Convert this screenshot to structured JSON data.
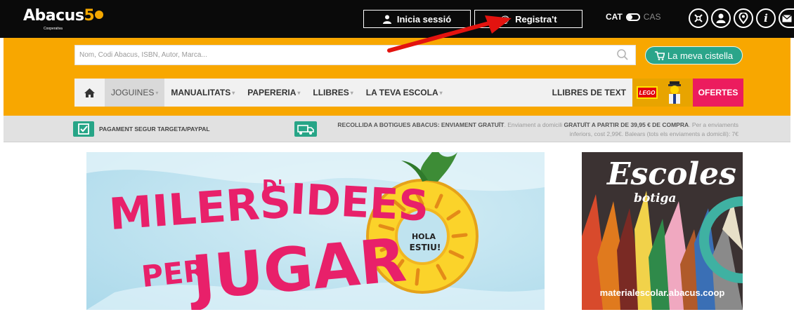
{
  "header": {
    "logo_text": "Abacus",
    "logo_number": "5",
    "logo_subtitle": "Cooperativa",
    "login_label": "Inicia sessió",
    "register_label": "Registra't",
    "lang_active": "CAT",
    "lang_inactive": "CAS",
    "icons": [
      "shop-icon",
      "user-icon",
      "location-icon",
      "info-icon",
      "mail-icon"
    ]
  },
  "search": {
    "placeholder": "Nom, Codi Abacus, ISBN, Autor, Marca..."
  },
  "cart": {
    "label": "La meva cistella"
  },
  "nav": {
    "items": [
      {
        "label": "JOGUINES",
        "dropdown": true,
        "active": true
      },
      {
        "label": "MANUALITATS",
        "dropdown": true
      },
      {
        "label": "PAPERERIA",
        "dropdown": true
      },
      {
        "label": "LLIBRES",
        "dropdown": true
      },
      {
        "label": "LA TEVA ESCOLA",
        "dropdown": true
      }
    ],
    "textbooks": "LLIBRES DE TEXT",
    "lego": "LEGO",
    "offers": "OFERTES"
  },
  "info": {
    "payment": "PAGAMENT SEGUR TARGETA/PAYPAL",
    "pickup": "RECOLLIDA A BOTIGUES ABACUS: ENVIAMENT GRATUÏT",
    "home_intro": ". Enviament a domicili",
    "free_from": "GRATUÏT A PARTIR DE 39,95 € DE COMPRA",
    "rest": ". Per a enviaments",
    "line2": "inferiors, cost 2,99€. Balears (tots els enviaments a domicili): 7€"
  },
  "banner": {
    "line1": "MILERS",
    "de": "D'",
    "ideas": "IDEES",
    "per": "PER",
    "jugar": "JUGAR",
    "float_text_1": "HOLA",
    "float_text_2": "ESTIU!"
  },
  "side_banner": {
    "title": "Escoles",
    "subtitle": "botiga",
    "url": "materialescolar.abacus.coop"
  },
  "colors": {
    "accent_orange": "#f8a700",
    "brand_green": "#27a587",
    "offers_pink": "#ec1c5e",
    "banner_pink": "#e8206a"
  }
}
